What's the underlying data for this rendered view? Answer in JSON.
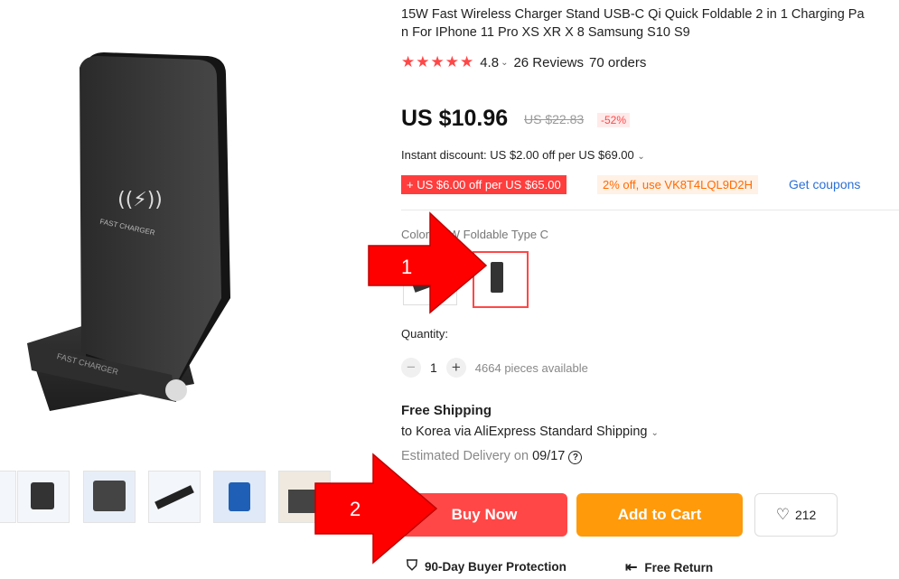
{
  "product": {
    "title": "15W Fast Wireless Charger Stand USB-C Qi Quick Foldable 2 in 1 Charging Pad Station For IPhone 11 Pro XS XR X 8 Samsung S10 S9",
    "title_line1": "15W Fast Wireless Charger Stand USB-C Qi Quick Foldable 2 in 1 Charging Pa",
    "title_line2": "n For IPhone 11 Pro XS XR X 8 Samsung S10 S9",
    "stars": "★★★★★",
    "rating": "4.8",
    "reviews": "26 Reviews",
    "orders": "70 orders",
    "device_text": "FAST CHARGER",
    "base_text": "FAST CHARGER"
  },
  "price": {
    "current": "US $10.96",
    "original": "US $22.83",
    "discount": "-52%",
    "instant_discount": "Instant discount: US $2.00 off per US $69.00"
  },
  "coupons": {
    "store_coupon": "+ US $6.00 off per US $65.00",
    "code_coupon": "2% off, use VK8T4LQL9D2H",
    "get_coupons": "Get coupons"
  },
  "color": {
    "label": "Color: 15W Foldable Type C"
  },
  "quantity": {
    "label": "Quantity:",
    "value": "1",
    "minus": "−",
    "plus": "+",
    "available": "4664 pieces available"
  },
  "shipping": {
    "title": "Free Shipping",
    "via": "to Korea via AliExpress Standard Shipping",
    "est_label": "Estimated Delivery on",
    "est_date": "09/17"
  },
  "actions": {
    "buy_now": "Buy Now",
    "add_to_cart": "Add to Cart",
    "wishlist_count": "212"
  },
  "guarantees": {
    "protection": "90-Day Buyer Protection",
    "free_return": "Free Return"
  },
  "annotations": {
    "marker1": "1",
    "marker2": "2"
  },
  "colors": {
    "accent_red": "#ff4747",
    "orange": "#ff9a0a",
    "arrow_red": "#ff0000",
    "link_blue": "#2b6fd6"
  }
}
